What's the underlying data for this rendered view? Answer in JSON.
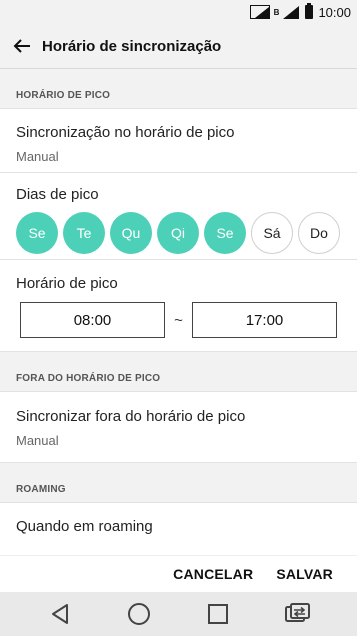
{
  "status_bar": {
    "time": "10:00",
    "network_tag": "B"
  },
  "app_bar": {
    "title": "Horário de sincronização"
  },
  "peak": {
    "header": "HORÁRIO DE PICO",
    "sync": {
      "title": "Sincronização no horário de pico",
      "value": "Manual"
    },
    "days": {
      "title": "Dias de pico",
      "items": [
        {
          "label": "Se",
          "selected": true
        },
        {
          "label": "Te",
          "selected": true
        },
        {
          "label": "Qu",
          "selected": true
        },
        {
          "label": "Qi",
          "selected": true
        },
        {
          "label": "Se",
          "selected": true
        },
        {
          "label": "Sá",
          "selected": false
        },
        {
          "label": "Do",
          "selected": false
        }
      ]
    },
    "hours": {
      "title": "Horário de pico",
      "start": "08:00",
      "separator": "~",
      "end": "17:00"
    }
  },
  "off_peak": {
    "header": "FORA DO HORÁRIO DE PICO",
    "sync": {
      "title": "Sincronizar fora do horário de pico",
      "value": "Manual"
    }
  },
  "roaming": {
    "header": "ROAMING",
    "item": {
      "title": "Quando em roaming"
    }
  },
  "actions": {
    "cancel": "CANCELAR",
    "save": "SALVAR"
  },
  "colors": {
    "accent": "#4dd0b8",
    "bar_bg": "#f2f2f2",
    "nav_bg": "#e9e9e9"
  }
}
